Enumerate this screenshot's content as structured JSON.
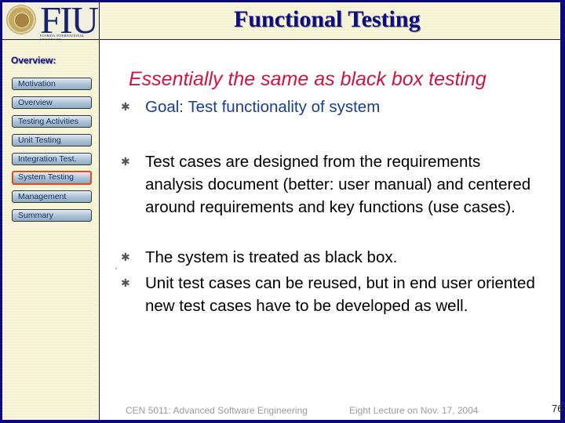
{
  "logo": {
    "text": "FIU",
    "subtext": "FLORIDA INTERNATIONAL UNIVERSITY"
  },
  "header": {
    "title": "Functional Testing"
  },
  "sidebar": {
    "label": "Overview:",
    "items": [
      {
        "label": "Motivation",
        "active": false
      },
      {
        "label": "Overview",
        "active": false
      },
      {
        "label": "Testing Activities",
        "active": false
      },
      {
        "label": "Unit Testing",
        "active": false
      },
      {
        "label": "Integration Test.",
        "active": false
      },
      {
        "label": "System Testing",
        "active": true
      },
      {
        "label": "Management",
        "active": false
      },
      {
        "label": "Summary",
        "active": false
      }
    ],
    "active_color": "#e24a1c"
  },
  "main": {
    "subtitle": "Essentially the same as black box testing",
    "bullet_icon": "asterisk-bullet-icon",
    "bullets": [
      {
        "text": "Goal: Test functionality of system"
      },
      {
        "text": "Test cases are designed from the requirements analysis document  (better: user manual) and centered around requirements and  key functions (use cases)."
      },
      {
        "text": "The system is treated as black box."
      },
      {
        "text": "Unit test cases can be reused, but in end user oriented new test cases have to be developed as well."
      }
    ]
  },
  "footer": {
    "course": "CEN 5011: Advanced Software Engineering",
    "lecture": "Eight Lecture on Nov. 17, 2004",
    "page": "76"
  },
  "colors": {
    "title": "#0d0d80",
    "subtitle": "#cf1540",
    "goal": "#1b3f8a",
    "frame": "#0a0a7a"
  }
}
